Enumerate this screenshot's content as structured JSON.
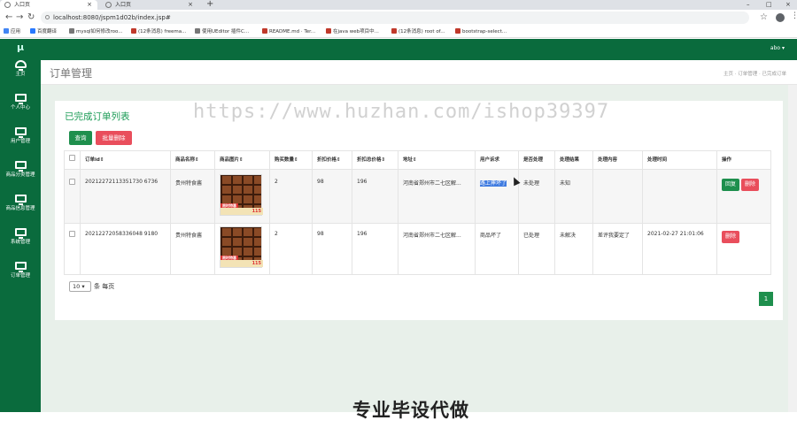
{
  "browser": {
    "tabs": [
      {
        "label": "入口页"
      },
      {
        "label": "入口页"
      }
    ],
    "new_tab": "+",
    "window_controls": [
      "–",
      "□",
      "×"
    ],
    "url": "localhost:8080/jspm1d02b/index.jsp#",
    "bookmarks": [
      {
        "label": "应用",
        "color": "#4285f4"
      },
      {
        "label": "百度翻译",
        "color": "#2979ff"
      },
      {
        "label": "mysql如何修改roo...",
        "color": "#777777"
      },
      {
        "label": "(12条消息) freema...",
        "color": "#c0392b"
      },
      {
        "label": "使用UEditor 插件C...",
        "color": "#777777"
      },
      {
        "label": "README.md · Ter...",
        "color": "#c0392b"
      },
      {
        "label": "在java web项目中...",
        "color": "#c0392b"
      },
      {
        "label": "(12条消息) root of...",
        "color": "#c0392b"
      },
      {
        "label": "bootstrap-select...",
        "color": "#c0392b"
      }
    ]
  },
  "app": {
    "logo": "μ",
    "user": "abo ▾",
    "sidebar": [
      {
        "label": "主页"
      },
      {
        "label": "个人中心"
      },
      {
        "label": "用户管理"
      },
      {
        "label": "商品分类管理"
      },
      {
        "label": "商品信息管理"
      },
      {
        "label": "系统管理"
      },
      {
        "label": "订单管理"
      }
    ],
    "page_title": "订单管理",
    "breadcrumb": "主页 · 订单管理 · 已完成订单"
  },
  "panel": {
    "title": "已完成订单列表",
    "search_label": "查询",
    "batch_delete_label": "批量删除",
    "columns": [
      "订单id",
      "商品名称",
      "商品图片",
      "购买数量",
      "折扣价格",
      "折扣总价格",
      "地址",
      "用户诉求",
      "是否处理",
      "处理结果",
      "处理内容",
      "处理时间",
      "操作"
    ],
    "rows": [
      {
        "id": "20212272113351730 6736",
        "name": "贵州特食酱",
        "image_tag": "115",
        "image_promo": "限时特惠",
        "qty": "2",
        "price": "98",
        "total": "196",
        "address": "河南省郑州市二七区解...",
        "appeal": "路上摔坏了",
        "handled": "未处理",
        "result": "未知",
        "content": "",
        "time": "",
        "actions": [
          "回复",
          "删除"
        ]
      },
      {
        "id": "20212272058336048 9180",
        "name": "贵州特食酱",
        "image_tag": "115",
        "image_promo": "限时特惠",
        "qty": "2",
        "price": "98",
        "total": "196",
        "address": "河南省郑州市二七区解...",
        "appeal": "商品坏了",
        "handled": "已处理",
        "result": "未解决",
        "content": "差评我要定了",
        "time": "2021-02-27 21:01:06",
        "actions": [
          "删除"
        ]
      }
    ],
    "page_size": "10",
    "page_size_suffix": "条 每页",
    "current_page": "1"
  },
  "overlay": {
    "watermark": "https://www.huzhan.com/ishop39397",
    "banner": "专业毕设代做"
  }
}
